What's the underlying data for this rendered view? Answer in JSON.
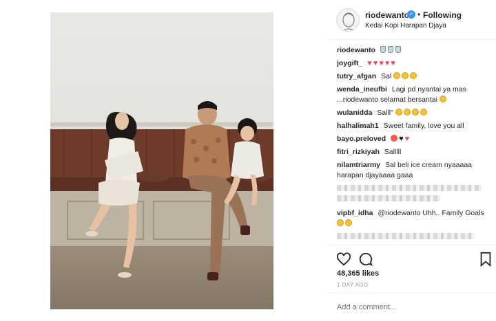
{
  "post": {
    "username": "riodewanto",
    "follow_status": "Following",
    "location": "Kedai Kopi Harapan Djaya",
    "likes": "48,365 likes",
    "time_ago": "1 DAY AGO",
    "add_comment_placeholder": "Add a comment..."
  },
  "comments": [
    {
      "user": "riodewanto",
      "text": "",
      "emoji": [
        "cup",
        "cup",
        "cup"
      ]
    },
    {
      "user": "joygift_",
      "text": "",
      "emoji": [
        "heart",
        "heart",
        "heart",
        "heart",
        "heart"
      ]
    },
    {
      "user": "tutry_afgan",
      "text": "Sal",
      "emoji": [
        "yellow-face",
        "yellow-face",
        "yellow-face"
      ]
    },
    {
      "user": "wenda_ineufbi",
      "text": "Lagi pd nyantai ya mas ...riodewanto selamat bersantai",
      "emoji": [
        "yellow-face"
      ]
    },
    {
      "user": "wulanidda",
      "text": "Salll\"",
      "emoji": [
        "yellow-face",
        "yellow-face",
        "yellow-face",
        "yellow-face"
      ]
    },
    {
      "user": "halhalimah1",
      "text": "Sweet family, love you all",
      "emoji": []
    },
    {
      "user": "bayo.preloved",
      "text": "",
      "emoji": [
        "red-face",
        "black-heart",
        "heart"
      ]
    },
    {
      "user": "fitri_rizkiyah",
      "text": "Salllll",
      "emoji": []
    },
    {
      "user": "nilamtriarmy",
      "text": "Sal beli ice cream nyaaaaa harapan djayaaaa gaaa",
      "emoji": []
    },
    {
      "user": "vipbf_idha",
      "text": "@riodewanto Uhh.. Family Goals",
      "emoji": [
        "family",
        "yellow-face"
      ]
    }
  ],
  "icons": {
    "like": "heart-outline-icon",
    "comment": "comment-bubble-icon",
    "save": "bookmark-icon",
    "verified": "verified-badge-icon"
  },
  "colors": {
    "verified": "#3897f0",
    "text": "#262626",
    "muted": "#999999",
    "divider": "#efefef",
    "heart": "#ed4956"
  }
}
